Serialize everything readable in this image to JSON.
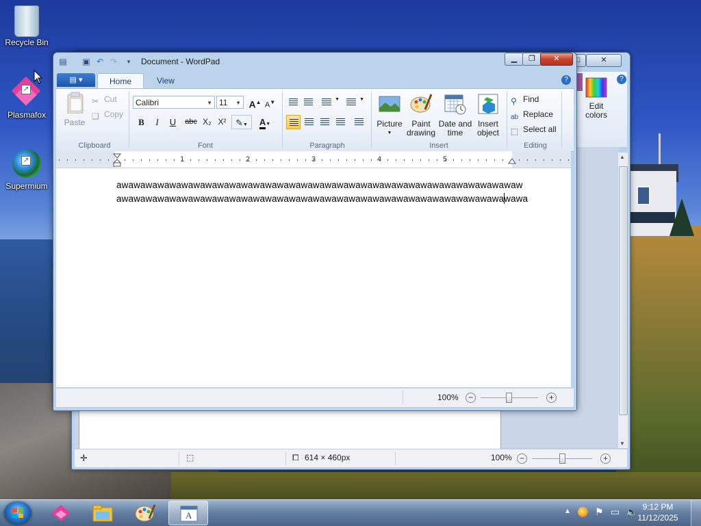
{
  "desktop": {
    "icons": [
      {
        "label": "Recycle Bin",
        "icon": "recycle-bin-icon"
      },
      {
        "label": "Plasmafox",
        "icon": "plasmafox-icon"
      },
      {
        "label": "Supermium",
        "icon": "supermium-icon"
      }
    ]
  },
  "paint_window": {
    "status": {
      "size_label": "614 × 460px",
      "zoom": "100%"
    }
  },
  "wordpad": {
    "title": "Document - WordPad",
    "tabs": [
      {
        "label": "Home",
        "active": true
      },
      {
        "label": "View",
        "active": false
      }
    ],
    "clipboard": {
      "group_label": "Clipboard",
      "paste": "Paste",
      "cut": "Cut",
      "copy": "Copy"
    },
    "font": {
      "group_label": "Font",
      "family": "Calibri",
      "size": "11",
      "bold": "B",
      "italic": "I",
      "underline": "U",
      "strike": "abc",
      "subscript": "X₂",
      "superscript": "X²",
      "text_color_glyph": "A",
      "grow_glyph": "A",
      "shrink_glyph": "A"
    },
    "paragraph": {
      "group_label": "Paragraph"
    },
    "insert": {
      "group_label": "Insert",
      "picture": "Picture",
      "paint_drawing_1": "Paint",
      "paint_drawing_2": "drawing",
      "date_time_1": "Date and",
      "date_time_2": "time",
      "insert_object_1": "Insert",
      "insert_object_2": "object"
    },
    "editing": {
      "group_label": "Editing",
      "find": "Find",
      "replace": "Replace",
      "select_all": "Select all"
    },
    "paint_edit_colors_1": "Edit",
    "paint_edit_colors_2": "colors",
    "ruler_numbers": [
      "1",
      "2",
      "3",
      "4",
      "5"
    ],
    "document_lines": [
      "awawawawawawawawawawawawawawawawawawawawawawawawawawawawawawawawawaw",
      "awawawawawawawawawawawawawawawawawawawawawawawawawawawawawawawawawawa"
    ],
    "status_zoom": "100%"
  },
  "taskbar": {
    "apps": [
      {
        "name": "plasmafox-taskbar-icon",
        "active": false
      },
      {
        "name": "file-explorer-taskbar-icon",
        "active": false
      },
      {
        "name": "paint-taskbar-icon",
        "active": false
      },
      {
        "name": "wordpad-taskbar-icon",
        "active": true
      }
    ],
    "clock_time": "9:12 PM",
    "clock_date": "11/12/2025"
  }
}
